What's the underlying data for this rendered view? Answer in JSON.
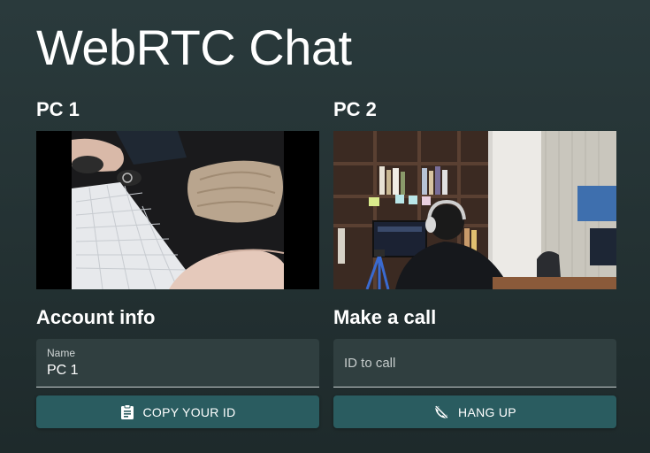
{
  "app": {
    "title": "WebRTC Chat"
  },
  "pc1": {
    "label": "PC 1",
    "section_title": "Account info",
    "name_field": {
      "label": "Name",
      "value": "PC 1"
    },
    "copy_button": {
      "label": "COPY YOUR ID",
      "icon": "clipboard-icon"
    }
  },
  "pc2": {
    "label": "PC 2",
    "section_title": "Make a call",
    "id_field": {
      "value": "",
      "placeholder": "ID to call"
    },
    "hangup_button": {
      "label": "HANG UP",
      "icon": "phone-off-icon"
    }
  },
  "colors": {
    "background": "#263435",
    "field_bg": "#303f40",
    "button_bg": "#2a5c60",
    "text": "#ffffff"
  }
}
